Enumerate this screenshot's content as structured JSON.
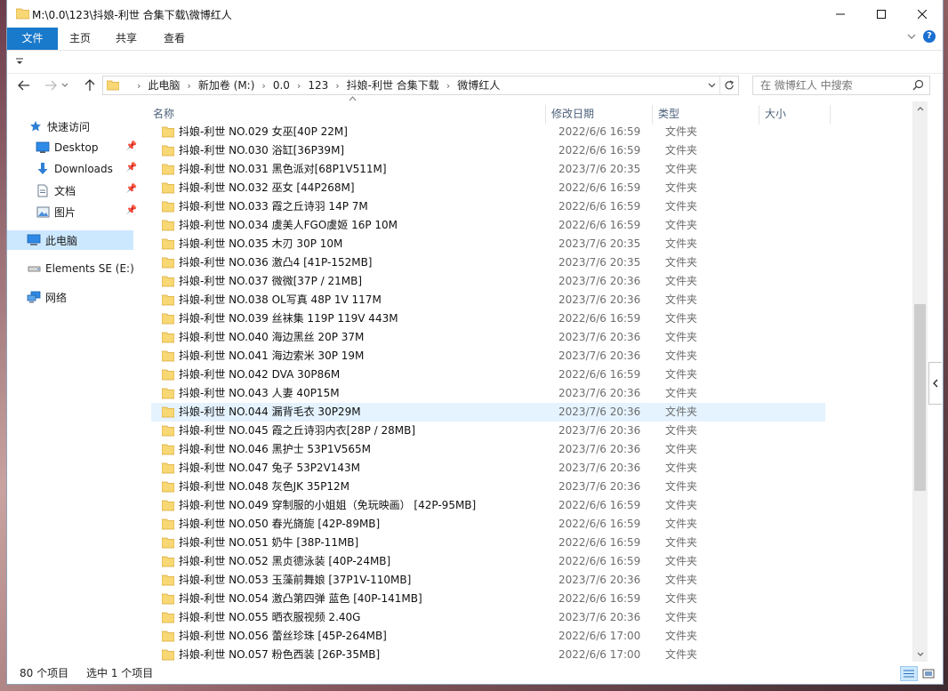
{
  "window": {
    "title": "M:\\0.0\\123\\抖娘-利世 合集下载\\微博红人"
  },
  "ribbon": {
    "tabs": [
      "文件",
      "主页",
      "共享",
      "查看"
    ]
  },
  "address": {
    "crumbs": [
      "此电脑",
      "新加卷 (M:)",
      "0.0",
      "123",
      "抖娘-利世 合集下载",
      "微博红人"
    ]
  },
  "search": {
    "placeholder": "在 微博红人 中搜索"
  },
  "sidebar": {
    "items": [
      {
        "label": "快速访问",
        "icon": "star-icon"
      },
      {
        "label": "Desktop",
        "icon": "desktop-icon",
        "pinned": true
      },
      {
        "label": "Downloads",
        "icon": "download-arrow-icon",
        "pinned": true
      },
      {
        "label": "文档",
        "icon": "document-icon",
        "pinned": true
      },
      {
        "label": "图片",
        "icon": "picture-icon",
        "pinned": true
      },
      {
        "label": "此电脑",
        "icon": "computer-icon",
        "selected": true
      },
      {
        "label": "Elements SE (E:)",
        "icon": "drive-icon"
      },
      {
        "label": "网络",
        "icon": "network-icon"
      }
    ]
  },
  "columns": {
    "name": "名称",
    "date": "修改日期",
    "type": "类型",
    "size": "大小"
  },
  "files": [
    {
      "name": "抖娘-利世 NO.029 女巫[40P 22M]",
      "date": "2022/6/6 16:59",
      "type": "文件夹"
    },
    {
      "name": "抖娘-利世 NO.030 浴缸[36P39M]",
      "date": "2022/6/6 16:59",
      "type": "文件夹"
    },
    {
      "name": "抖娘-利世 NO.031 黑色派对[68P1V511M]",
      "date": "2023/7/6 20:35",
      "type": "文件夹"
    },
    {
      "name": "抖娘-利世 NO.032 巫女 [44P268M]",
      "date": "2022/6/6 16:59",
      "type": "文件夹"
    },
    {
      "name": "抖娘-利世 NO.033 霞之丘诗羽 14P 7M",
      "date": "2022/6/6 16:59",
      "type": "文件夹"
    },
    {
      "name": "抖娘-利世 NO.034 虞美人FGO虞姬 16P 10M",
      "date": "2022/6/6 16:59",
      "type": "文件夹"
    },
    {
      "name": "抖娘-利世 NO.035 木刃 30P 10M",
      "date": "2023/7/6 20:35",
      "type": "文件夹"
    },
    {
      "name": "抖娘-利世 NO.036 激凸4 [41P-152MB]",
      "date": "2023/7/6 20:35",
      "type": "文件夹"
    },
    {
      "name": "抖娘-利世 NO.037 微微[37P / 21MB]",
      "date": "2023/7/6 20:36",
      "type": "文件夹"
    },
    {
      "name": "抖娘-利世 NO.038 OL写真 48P 1V 117M",
      "date": "2023/7/6 20:36",
      "type": "文件夹"
    },
    {
      "name": "抖娘-利世 NO.039 丝袜集 119P 119V 443M",
      "date": "2022/6/6 16:59",
      "type": "文件夹"
    },
    {
      "name": "抖娘-利世 NO.040 海边黑丝 20P 37M",
      "date": "2023/7/6 20:36",
      "type": "文件夹"
    },
    {
      "name": "抖娘-利世 NO.041 海边索米 30P 19M",
      "date": "2023/7/6 20:36",
      "type": "文件夹"
    },
    {
      "name": "抖娘-利世 NO.042 DVA 30P86M",
      "date": "2022/6/6 16:59",
      "type": "文件夹"
    },
    {
      "name": "抖娘-利世 NO.043 人妻 40P15M",
      "date": "2023/7/6 20:36",
      "type": "文件夹"
    },
    {
      "name": "抖娘-利世 NO.044 漏背毛衣 30P29M",
      "date": "2023/7/6 20:36",
      "type": "文件夹",
      "selected": true
    },
    {
      "name": "抖娘-利世 NO.045 霞之丘诗羽内衣[28P / 28MB]",
      "date": "2023/7/6 20:36",
      "type": "文件夹"
    },
    {
      "name": "抖娘-利世 NO.046 黑护士 53P1V565M",
      "date": "2023/7/6 20:36",
      "type": "文件夹"
    },
    {
      "name": "抖娘-利世 NO.047 兔子 53P2V143M",
      "date": "2023/7/6 20:36",
      "type": "文件夹"
    },
    {
      "name": "抖娘-利世 NO.048 灰色JK 35P12M",
      "date": "2023/7/6 20:36",
      "type": "文件夹"
    },
    {
      "name": "抖娘-利世 NO.049 穿制服的小姐姐（免玩映画） [42P-95MB]",
      "date": "2022/6/6 16:59",
      "type": "文件夹"
    },
    {
      "name": "抖娘-利世 NO.050 春光旖旎 [42P-89MB]",
      "date": "2022/6/6 16:59",
      "type": "文件夹"
    },
    {
      "name": "抖娘-利世 NO.051 奶牛 [38P-11MB]",
      "date": "2022/6/6 16:59",
      "type": "文件夹"
    },
    {
      "name": "抖娘-利世 NO.052 黑贞德泳装 [40P-24MB]",
      "date": "2022/6/6 16:59",
      "type": "文件夹"
    },
    {
      "name": "抖娘-利世 NO.053 玉藻前舞娘 [37P1V-110MB]",
      "date": "2023/7/6 20:36",
      "type": "文件夹"
    },
    {
      "name": "抖娘-利世 NO.054 激凸第四弹 蓝色 [40P-141MB]",
      "date": "2022/6/6 16:59",
      "type": "文件夹"
    },
    {
      "name": "抖娘-利世 NO.055 晒衣服视频 2.40G",
      "date": "2023/7/6 20:36",
      "type": "文件夹"
    },
    {
      "name": "抖娘-利世 NO.056 蕾丝珍珠 [45P-264MB]",
      "date": "2022/6/6 17:00",
      "type": "文件夹"
    },
    {
      "name": "抖娘-利世 NO.057 粉色西装 [26P-35MB]",
      "date": "2022/6/6 17:00",
      "type": "文件夹"
    }
  ],
  "status": {
    "count": "80 个项目",
    "selected": "选中 1 个项目"
  },
  "colors": {
    "accent": "#1979ca",
    "selection": "#cce8ff",
    "row_selected": "#e5f3ff",
    "folder": "#f8d775"
  }
}
